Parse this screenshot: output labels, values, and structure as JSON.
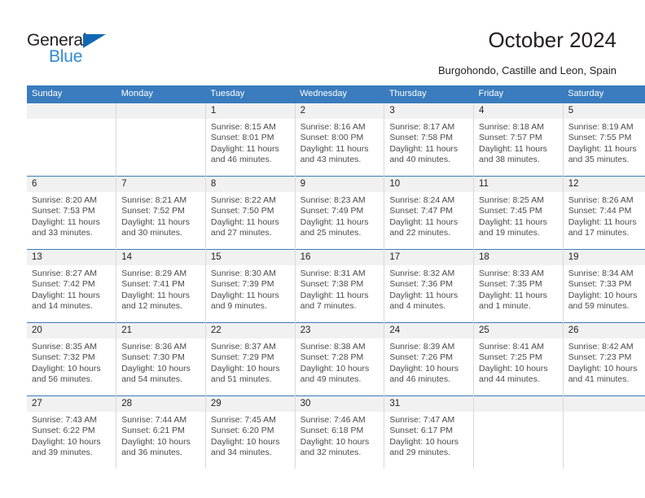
{
  "logo": {
    "word_dark": "General",
    "word_blue": "Blue",
    "triangle_color": "#1268b3",
    "blue_color": "#2e8bd4"
  },
  "header": {
    "title": "October 2024",
    "subtitle": "Burgohondo, Castille and Leon, Spain",
    "header_bg_color": "#3a7cbe",
    "daynum_bg_color": "#f1f1f1"
  },
  "weekday_headers": [
    "Sunday",
    "Monday",
    "Tuesday",
    "Wednesday",
    "Thursday",
    "Friday",
    "Saturday"
  ],
  "weeks": [
    [
      {
        "day": "",
        "sunrise": "",
        "sunset": "",
        "daylight_line1": "",
        "daylight_line2": "",
        "blank": true
      },
      {
        "day": "",
        "sunrise": "",
        "sunset": "",
        "daylight_line1": "",
        "daylight_line2": "",
        "blank": true
      },
      {
        "day": "1",
        "sunrise": "Sunrise: 8:15 AM",
        "sunset": "Sunset: 8:01 PM",
        "daylight_line1": "Daylight: 11 hours",
        "daylight_line2": "and 46 minutes."
      },
      {
        "day": "2",
        "sunrise": "Sunrise: 8:16 AM",
        "sunset": "Sunset: 8:00 PM",
        "daylight_line1": "Daylight: 11 hours",
        "daylight_line2": "and 43 minutes."
      },
      {
        "day": "3",
        "sunrise": "Sunrise: 8:17 AM",
        "sunset": "Sunset: 7:58 PM",
        "daylight_line1": "Daylight: 11 hours",
        "daylight_line2": "and 40 minutes."
      },
      {
        "day": "4",
        "sunrise": "Sunrise: 8:18 AM",
        "sunset": "Sunset: 7:57 PM",
        "daylight_line1": "Daylight: 11 hours",
        "daylight_line2": "and 38 minutes."
      },
      {
        "day": "5",
        "sunrise": "Sunrise: 8:19 AM",
        "sunset": "Sunset: 7:55 PM",
        "daylight_line1": "Daylight: 11 hours",
        "daylight_line2": "and 35 minutes."
      }
    ],
    [
      {
        "day": "6",
        "sunrise": "Sunrise: 8:20 AM",
        "sunset": "Sunset: 7:53 PM",
        "daylight_line1": "Daylight: 11 hours",
        "daylight_line2": "and 33 minutes."
      },
      {
        "day": "7",
        "sunrise": "Sunrise: 8:21 AM",
        "sunset": "Sunset: 7:52 PM",
        "daylight_line1": "Daylight: 11 hours",
        "daylight_line2": "and 30 minutes."
      },
      {
        "day": "8",
        "sunrise": "Sunrise: 8:22 AM",
        "sunset": "Sunset: 7:50 PM",
        "daylight_line1": "Daylight: 11 hours",
        "daylight_line2": "and 27 minutes."
      },
      {
        "day": "9",
        "sunrise": "Sunrise: 8:23 AM",
        "sunset": "Sunset: 7:49 PM",
        "daylight_line1": "Daylight: 11 hours",
        "daylight_line2": "and 25 minutes."
      },
      {
        "day": "10",
        "sunrise": "Sunrise: 8:24 AM",
        "sunset": "Sunset: 7:47 PM",
        "daylight_line1": "Daylight: 11 hours",
        "daylight_line2": "and 22 minutes."
      },
      {
        "day": "11",
        "sunrise": "Sunrise: 8:25 AM",
        "sunset": "Sunset: 7:45 PM",
        "daylight_line1": "Daylight: 11 hours",
        "daylight_line2": "and 19 minutes."
      },
      {
        "day": "12",
        "sunrise": "Sunrise: 8:26 AM",
        "sunset": "Sunset: 7:44 PM",
        "daylight_line1": "Daylight: 11 hours",
        "daylight_line2": "and 17 minutes."
      }
    ],
    [
      {
        "day": "13",
        "sunrise": "Sunrise: 8:27 AM",
        "sunset": "Sunset: 7:42 PM",
        "daylight_line1": "Daylight: 11 hours",
        "daylight_line2": "and 14 minutes."
      },
      {
        "day": "14",
        "sunrise": "Sunrise: 8:29 AM",
        "sunset": "Sunset: 7:41 PM",
        "daylight_line1": "Daylight: 11 hours",
        "daylight_line2": "and 12 minutes."
      },
      {
        "day": "15",
        "sunrise": "Sunrise: 8:30 AM",
        "sunset": "Sunset: 7:39 PM",
        "daylight_line1": "Daylight: 11 hours",
        "daylight_line2": "and 9 minutes."
      },
      {
        "day": "16",
        "sunrise": "Sunrise: 8:31 AM",
        "sunset": "Sunset: 7:38 PM",
        "daylight_line1": "Daylight: 11 hours",
        "daylight_line2": "and 7 minutes."
      },
      {
        "day": "17",
        "sunrise": "Sunrise: 8:32 AM",
        "sunset": "Sunset: 7:36 PM",
        "daylight_line1": "Daylight: 11 hours",
        "daylight_line2": "and 4 minutes."
      },
      {
        "day": "18",
        "sunrise": "Sunrise: 8:33 AM",
        "sunset": "Sunset: 7:35 PM",
        "daylight_line1": "Daylight: 11 hours",
        "daylight_line2": "and 1 minute."
      },
      {
        "day": "19",
        "sunrise": "Sunrise: 8:34 AM",
        "sunset": "Sunset: 7:33 PM",
        "daylight_line1": "Daylight: 10 hours",
        "daylight_line2": "and 59 minutes."
      }
    ],
    [
      {
        "day": "20",
        "sunrise": "Sunrise: 8:35 AM",
        "sunset": "Sunset: 7:32 PM",
        "daylight_line1": "Daylight: 10 hours",
        "daylight_line2": "and 56 minutes."
      },
      {
        "day": "21",
        "sunrise": "Sunrise: 8:36 AM",
        "sunset": "Sunset: 7:30 PM",
        "daylight_line1": "Daylight: 10 hours",
        "daylight_line2": "and 54 minutes."
      },
      {
        "day": "22",
        "sunrise": "Sunrise: 8:37 AM",
        "sunset": "Sunset: 7:29 PM",
        "daylight_line1": "Daylight: 10 hours",
        "daylight_line2": "and 51 minutes."
      },
      {
        "day": "23",
        "sunrise": "Sunrise: 8:38 AM",
        "sunset": "Sunset: 7:28 PM",
        "daylight_line1": "Daylight: 10 hours",
        "daylight_line2": "and 49 minutes."
      },
      {
        "day": "24",
        "sunrise": "Sunrise: 8:39 AM",
        "sunset": "Sunset: 7:26 PM",
        "daylight_line1": "Daylight: 10 hours",
        "daylight_line2": "and 46 minutes."
      },
      {
        "day": "25",
        "sunrise": "Sunrise: 8:41 AM",
        "sunset": "Sunset: 7:25 PM",
        "daylight_line1": "Daylight: 10 hours",
        "daylight_line2": "and 44 minutes."
      },
      {
        "day": "26",
        "sunrise": "Sunrise: 8:42 AM",
        "sunset": "Sunset: 7:23 PM",
        "daylight_line1": "Daylight: 10 hours",
        "daylight_line2": "and 41 minutes."
      }
    ],
    [
      {
        "day": "27",
        "sunrise": "Sunrise: 7:43 AM",
        "sunset": "Sunset: 6:22 PM",
        "daylight_line1": "Daylight: 10 hours",
        "daylight_line2": "and 39 minutes."
      },
      {
        "day": "28",
        "sunrise": "Sunrise: 7:44 AM",
        "sunset": "Sunset: 6:21 PM",
        "daylight_line1": "Daylight: 10 hours",
        "daylight_line2": "and 36 minutes."
      },
      {
        "day": "29",
        "sunrise": "Sunrise: 7:45 AM",
        "sunset": "Sunset: 6:20 PM",
        "daylight_line1": "Daylight: 10 hours",
        "daylight_line2": "and 34 minutes."
      },
      {
        "day": "30",
        "sunrise": "Sunrise: 7:46 AM",
        "sunset": "Sunset: 6:18 PM",
        "daylight_line1": "Daylight: 10 hours",
        "daylight_line2": "and 32 minutes."
      },
      {
        "day": "31",
        "sunrise": "Sunrise: 7:47 AM",
        "sunset": "Sunset: 6:17 PM",
        "daylight_line1": "Daylight: 10 hours",
        "daylight_line2": "and 29 minutes."
      },
      {
        "day": "",
        "sunrise": "",
        "sunset": "",
        "daylight_line1": "",
        "daylight_line2": "",
        "blank": true
      },
      {
        "day": "",
        "sunrise": "",
        "sunset": "",
        "daylight_line1": "",
        "daylight_line2": "",
        "blank": true
      }
    ]
  ]
}
